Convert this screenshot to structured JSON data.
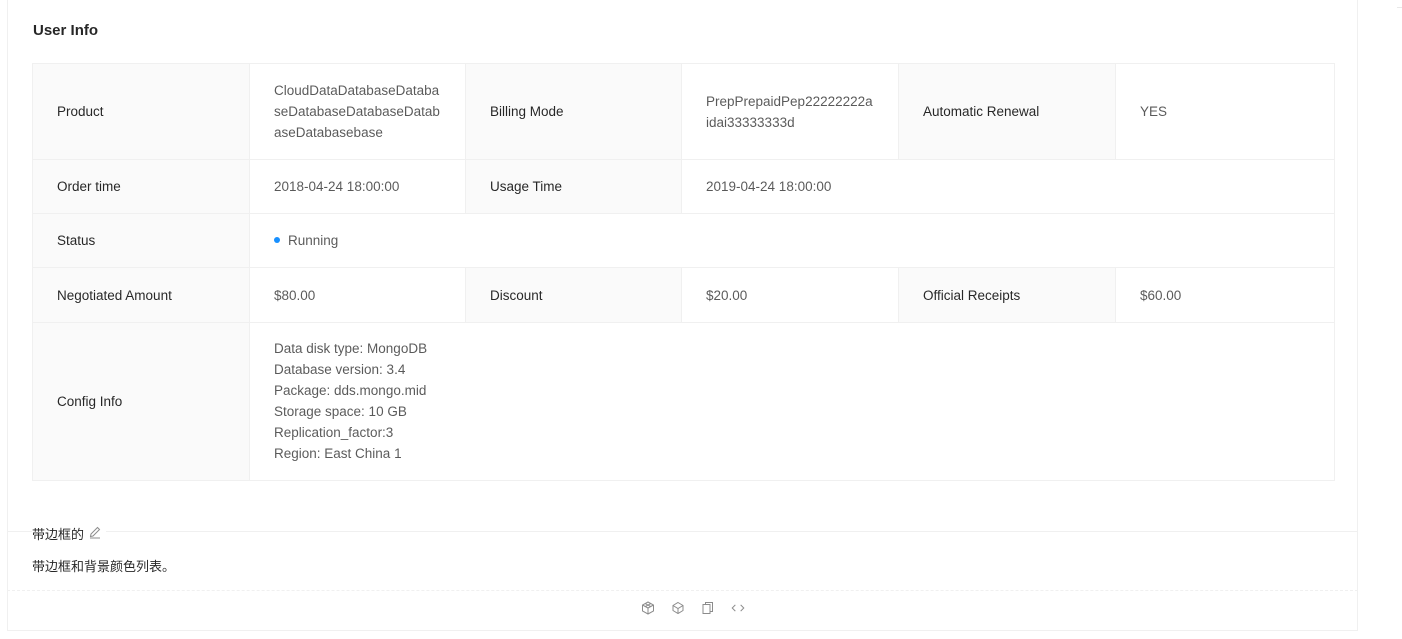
{
  "title": "User Info",
  "rows": [
    {
      "items": [
        {
          "label": "Product",
          "value": "CloudDataDatabaseDatabaseDatabaseDatabaseDatabaseDatabasebase"
        },
        {
          "label": "Billing Mode",
          "value": "PrepPrepaidPep22222222aidai33333333d"
        },
        {
          "label": "Automatic Renewal",
          "value": "YES"
        }
      ]
    },
    {
      "items": [
        {
          "label": "Order time",
          "value": "2018-04-24 18:00:00"
        },
        {
          "label": "Usage Time",
          "value": "2019-04-24 18:00:00"
        }
      ]
    },
    {
      "items": [
        {
          "label": "Status",
          "value": "Running"
        }
      ]
    },
    {
      "items": [
        {
          "label": "Negotiated Amount",
          "value": "$80.00"
        },
        {
          "label": "Discount",
          "value": "$20.00"
        },
        {
          "label": "Official Receipts",
          "value": "$60.00"
        }
      ]
    },
    {
      "items": [
        {
          "label": "Config Info",
          "lines": [
            "Data disk type: MongoDB",
            "Database version: 3.4",
            "Package: dds.mongo.mid",
            "Storage space: 10 GB",
            "Replication_factor:3",
            "Region: East China 1"
          ]
        }
      ]
    }
  ],
  "status_color": "#1890ff",
  "demo": {
    "title": "带边框的",
    "description": "带边框和背景颜色列表。",
    "actions": [
      "codesandbox-icon",
      "codepen-icon",
      "copy-icon",
      "code-expand-icon"
    ]
  }
}
